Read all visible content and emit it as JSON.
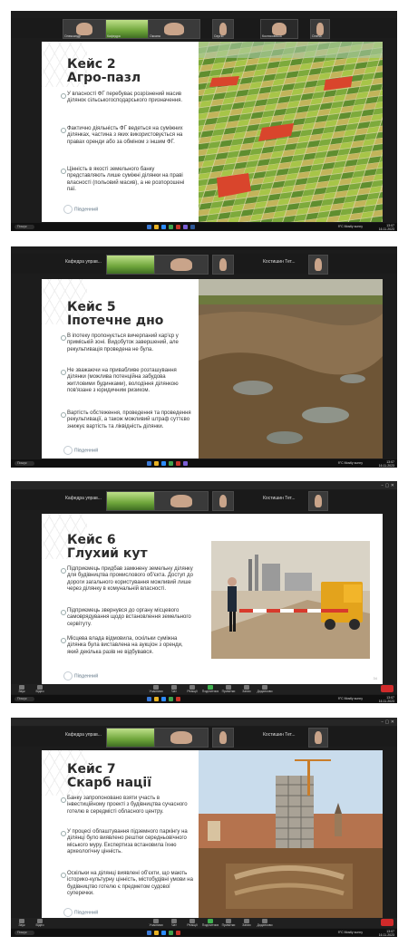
{
  "panels": [
    {
      "title_line1": "Кейс 2",
      "title_line2": "Агро-пазл",
      "bullets": [
        "У власності ФГ перебуває розрізнений масив ділянок сільськогосподарського призначення.",
        "Фактично діяльність ФГ ведеться на суміжних ділянках, частина з яких використовується на правах оренди або за обміном з іншим ФГ.",
        "Цінність в якості земельного банку представляють лише суміжні ділянки на праві власності (польовий масив), а не розпорошені паї."
      ],
      "logo_text": "Південний",
      "image_kind": "aerial-fields",
      "participants": [
        "Олександр",
        "Кафедра",
        "Оксана",
        "Сергій",
        "Костиковська",
        "Олена"
      ]
    },
    {
      "title_line1": "Кейс 5",
      "title_line2": "Іпотечне дно",
      "bullets": [
        "В іпотеку пропонується вичерпаний кар'єр у приміській зоні. Видобуток завершений, але рекультивація проведена не була.",
        "Не зважаючи на привабливе розташування ділянки (можлива потенційна забудова житловими будинками), володіння ділянкою пов'язане з юридичним ризиком.",
        "Вартість обстеження, проведення та проведення рекультивації, а також можливий штраф суттєво знижує вартість та ліквідність ділянки."
      ],
      "logo_text": "Південний",
      "image_kind": "quarry",
      "window_labels": [
        "Кафедра управ...",
        "Костишин Тет..."
      ]
    },
    {
      "title_line1": "Кейс 6",
      "title_line2": "Глухий кут",
      "bullets": [
        "Підприємець придбав замкнену земельну ділянку для будівництва промислового об'єкта. Доступ до дороги загального користування можливий лише через ділянку в комунальній власності.",
        "Підприємець звернувся до органу місцевого самоврядування щодо встановлення земельного сервітуту.",
        "Місцева влада відмовила, оскільки суміжна ділянка була виставлена на аукціон з оренди, який декілька разів не відбувався."
      ],
      "logo_text": "Південний",
      "page_number": "34",
      "image_kind": "truck-barrier",
      "window_labels": [
        "Кафедра управ...",
        "Костишин Тет..."
      ]
    },
    {
      "title_line1": "Кейс 7",
      "title_line2": "Скарб нації",
      "bullets": [
        "Банку запропоновано взяти участь в інвестиційному проекті з будівництва сучасного готелю в середмісті обласного центру.",
        "У процесі облаштування підземного паркінгу на ділянці було виявлено рештки середньовічного міського муру. Експертиза встановила їхню археологічну цінність.",
        "Оскільки на ділянці виявлені об'єкти, що мають історико-культурну цінність, містобудівні умови на будівництво готелю є предметом судової суперечки."
      ],
      "logo_text": "Південний",
      "image_kind": "building-excavation",
      "window_labels": [
        "Кафедра управ...",
        "Костишин Тет..."
      ]
    }
  ],
  "zoom_controls": [
    "Звук",
    "Відео",
    "Учасники",
    "Чат",
    "Реакції",
    "Поділитися",
    "Примітки",
    "Запис",
    "Додатково"
  ],
  "leave_label": "Вийти",
  "taskbar": {
    "search": "Пошук",
    "weather": "9°C  Mostly sunny",
    "time": "13:07",
    "date": "16.11.2023"
  }
}
